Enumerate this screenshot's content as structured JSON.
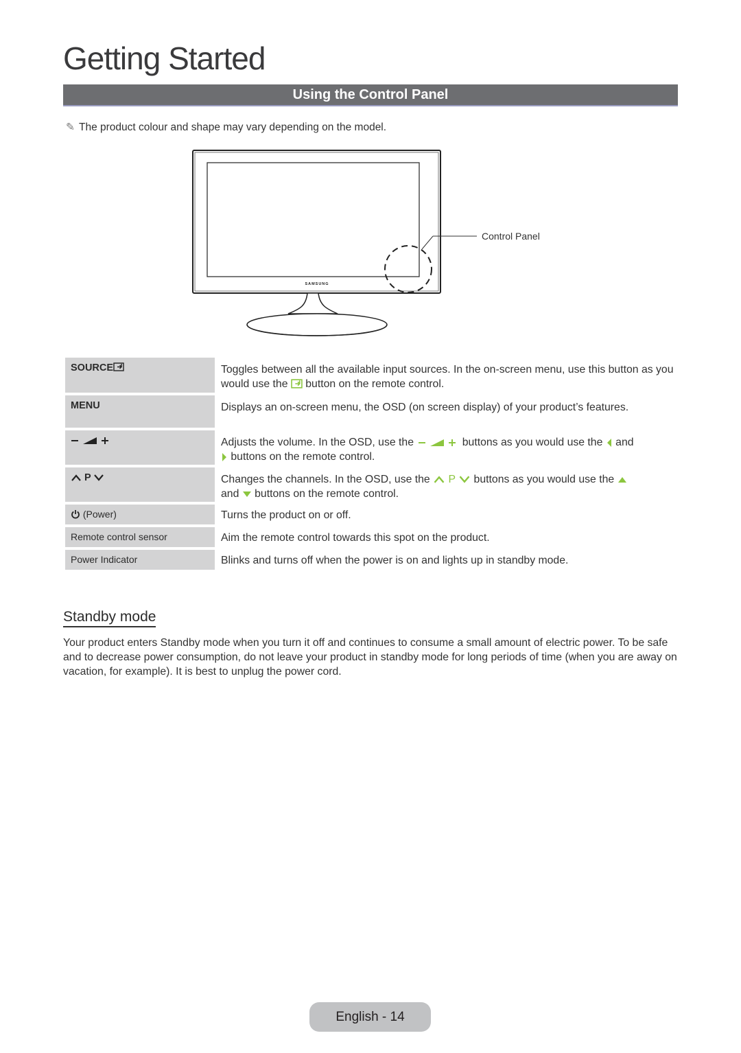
{
  "chapter_title": "Getting Started",
  "section_title": "Using the Control Panel",
  "note": {
    "icon": "pencil-icon",
    "text": "The product colour and shape may vary depending on the model."
  },
  "diagram": {
    "brand": "SAMSUNG",
    "callout_label": "Control Panel"
  },
  "controls": [
    {
      "key": "SOURCE",
      "key_icon": "source-icon",
      "desc_parts": [
        "Toggles between all the available input sources. In the on-screen menu, use this button as you would use the ",
        " button on the remote control."
      ]
    },
    {
      "key": "MENU",
      "desc": "Displays an on-screen menu, the OSD (on screen display) of your product’s features."
    },
    {
      "key": "– ◢ +",
      "desc_parts": [
        "Adjusts the volume. In the OSD, use the ",
        " buttons as you would use the ",
        " and ",
        " buttons on the remote control."
      ],
      "osd_symbol": "– ◢ +"
    },
    {
      "key": "P",
      "desc_parts": [
        "Changes the channels. In the OSD, use the ",
        " buttons as you would use the ",
        " and ",
        " buttons on the remote control."
      ],
      "osd_symbol": "P"
    },
    {
      "key": "(Power)",
      "key_icon": "power-icon",
      "desc": "Turns the product on or off."
    },
    {
      "key": "Remote control sensor",
      "desc": "Aim the remote control towards this spot on the product."
    },
    {
      "key": "Power Indicator",
      "desc": "Blinks and turns off when the power is on and lights up in standby mode."
    }
  ],
  "standby": {
    "title": "Standby mode",
    "text": "Your product enters Standby mode when you turn it off and continues to consume a small amount of electric power. To be safe and to decrease power consumption, do not leave your product in standby mode for long periods of time (when you are away on vacation, for example). It is best to unplug the power cord."
  },
  "footer": {
    "page_label": "English - 14"
  },
  "colors": {
    "accent_green": "#8cc63f",
    "section_bar": "#6d6e71",
    "table_key_bg": "#d3d3d4"
  }
}
